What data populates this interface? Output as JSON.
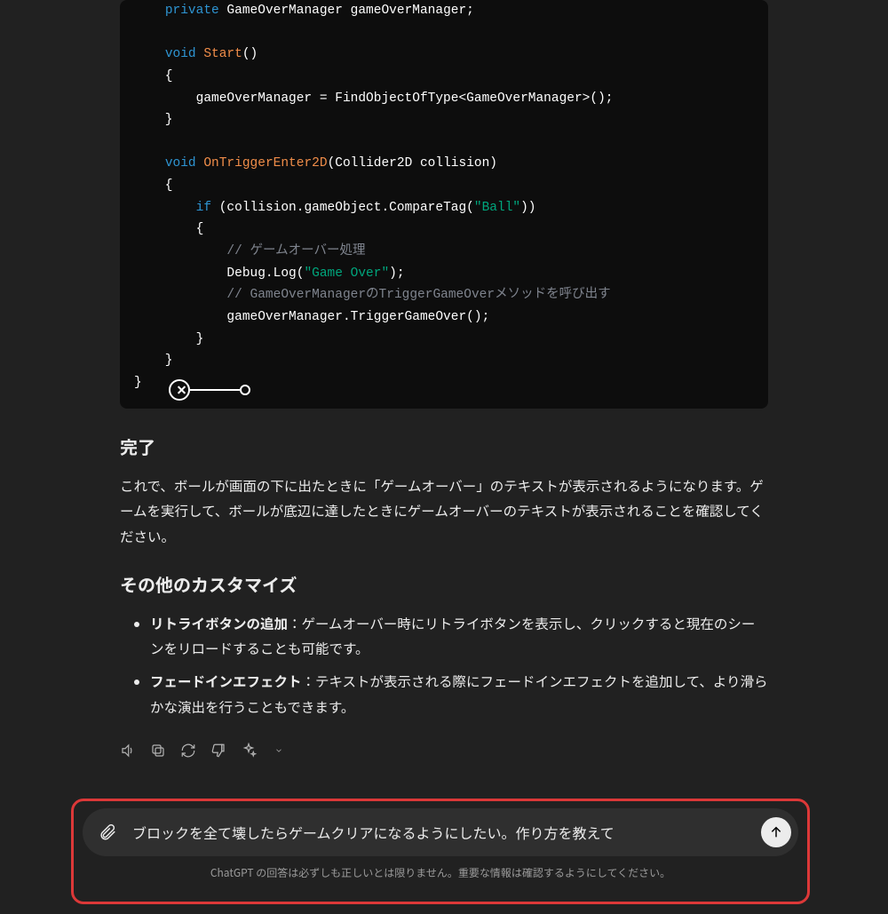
{
  "code": {
    "lines": [
      {
        "indent": 1,
        "parts": [
          {
            "t": "private",
            "c": "k-private"
          },
          {
            "t": " GameOverManager gameOverManager;",
            "c": ""
          }
        ]
      },
      {
        "indent": 0,
        "parts": [
          {
            "t": "",
            "c": ""
          }
        ]
      },
      {
        "indent": 1,
        "parts": [
          {
            "t": "void",
            "c": "k-void"
          },
          {
            "t": " ",
            "c": ""
          },
          {
            "t": "Start",
            "c": "method-name"
          },
          {
            "t": "()",
            "c": ""
          }
        ]
      },
      {
        "indent": 1,
        "parts": [
          {
            "t": "{",
            "c": ""
          }
        ]
      },
      {
        "indent": 2,
        "parts": [
          {
            "t": "gameOverManager = FindObjectOfType<GameOverManager>();",
            "c": ""
          }
        ]
      },
      {
        "indent": 1,
        "parts": [
          {
            "t": "}",
            "c": ""
          }
        ]
      },
      {
        "indent": 0,
        "parts": [
          {
            "t": "",
            "c": ""
          }
        ]
      },
      {
        "indent": 1,
        "parts": [
          {
            "t": "void",
            "c": "k-void"
          },
          {
            "t": " ",
            "c": ""
          },
          {
            "t": "OnTriggerEnter2D",
            "c": "method-name"
          },
          {
            "t": "(Collider2D collision)",
            "c": ""
          }
        ]
      },
      {
        "indent": 1,
        "parts": [
          {
            "t": "{",
            "c": ""
          }
        ]
      },
      {
        "indent": 2,
        "parts": [
          {
            "t": "if",
            "c": "k-if"
          },
          {
            "t": " (collision.gameObject.CompareTag(",
            "c": ""
          },
          {
            "t": "\"Ball\"",
            "c": "string"
          },
          {
            "t": "))",
            "c": ""
          }
        ]
      },
      {
        "indent": 2,
        "parts": [
          {
            "t": "{",
            "c": ""
          }
        ]
      },
      {
        "indent": 3,
        "parts": [
          {
            "t": "// ゲームオーバー処理",
            "c": "comment"
          }
        ]
      },
      {
        "indent": 3,
        "parts": [
          {
            "t": "Debug.Log(",
            "c": ""
          },
          {
            "t": "\"Game Over\"",
            "c": "string"
          },
          {
            "t": ");",
            "c": ""
          }
        ]
      },
      {
        "indent": 3,
        "parts": [
          {
            "t": "// GameOverManagerのTriggerGameOverメソッドを呼び出す",
            "c": "comment"
          }
        ]
      },
      {
        "indent": 3,
        "parts": [
          {
            "t": "gameOverManager.TriggerGameOver();",
            "c": ""
          }
        ]
      },
      {
        "indent": 2,
        "parts": [
          {
            "t": "}",
            "c": ""
          }
        ]
      },
      {
        "indent": 1,
        "parts": [
          {
            "t": "}",
            "c": ""
          }
        ]
      },
      {
        "indent": 0,
        "parts": [
          {
            "t": "}",
            "c": ""
          }
        ]
      }
    ]
  },
  "sections": {
    "done_heading": "完了",
    "done_body": "これで、ボールが画面の下に出たときに「ゲームオーバー」のテキストが表示されるようになります。ゲームを実行して、ボールが底辺に達したときにゲームオーバーのテキストが表示されることを確認してください。",
    "custom_heading": "その他のカスタマイズ",
    "bullets": [
      {
        "bold": "リトライボタンの追加",
        "rest": "：ゲームオーバー時にリトライボタンを表示し、クリックすると現在のシーンをリロードすることも可能です。"
      },
      {
        "bold": "フェードインエフェクト",
        "rest": "：テキストが表示される際にフェードインエフェクトを追加して、より滑らかな演出を行うこともできます。"
      }
    ]
  },
  "composer": {
    "value": "ブロックを全て壊したらゲームクリアになるようにしたい。作り方を教えて",
    "disclaimer": "ChatGPT の回答は必ずしも正しいとは限りません。重要な情報は確認するようにしてください。"
  },
  "icons": {
    "speaker": "speaker-icon",
    "copy": "copy-icon",
    "regenerate": "regenerate-icon",
    "thumbs_down": "thumbs-down-icon",
    "sparkle": "sparkle-icon",
    "attach": "paperclip-icon",
    "send": "arrow-up-icon"
  }
}
